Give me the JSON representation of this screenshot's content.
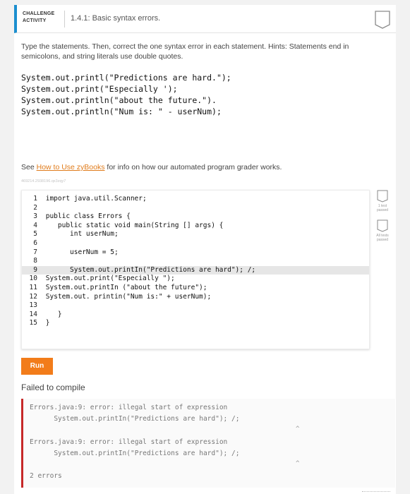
{
  "header": {
    "badge_line1": "CHALLENGE",
    "badge_line2": "ACTIVITY",
    "title": "1.4.1: Basic syntax errors."
  },
  "prompt": "Type the statements. Then, correct the one syntax error in each statement. Hints: Statements end in semicolons, and string literals use double quotes.",
  "statements": [
    "System.out.printl(\"Predictions are hard.\");",
    "System.out.print(\"Especially ');",
    "System.out.println(\"about the future.\").",
    "System.out.println(\"Num is: \" - userNum);"
  ],
  "see_note": {
    "prefix": "See ",
    "link": "How to Use zyBooks",
    "suffix": " for info on how our automated program grader works."
  },
  "identifier": "469214.2938196.qx3zqy7",
  "code": {
    "lines": [
      {
        "n": "1",
        "text": " import java.util.Scanner;"
      },
      {
        "n": "2",
        "text": ""
      },
      {
        "n": "3",
        "text": " public class Errors {"
      },
      {
        "n": "4",
        "text": "    public static void main(String [] args) {"
      },
      {
        "n": "5",
        "text": "       int userNum;"
      },
      {
        "n": "6",
        "text": ""
      },
      {
        "n": "7",
        "text": "       userNum = 5;"
      },
      {
        "n": "8",
        "text": ""
      },
      {
        "n": "9",
        "text": "       System.out.printIn(\"Predictions are hard\"); /;"
      },
      {
        "n": "10",
        "text": " System.out.print(\"Especially \");"
      },
      {
        "n": "11",
        "text": " System.out.printIn (\"about the future\");"
      },
      {
        "n": "12",
        "text": " System.out. printin(\"Num is:\" + userNum);"
      },
      {
        "n": "13",
        "text": ""
      },
      {
        "n": "14",
        "text": "    }"
      },
      {
        "n": "15",
        "text": " }"
      }
    ]
  },
  "tests": [
    {
      "label": "1 test passed"
    },
    {
      "label": "All tests passed"
    }
  ],
  "run_label": "Run",
  "status": "Failed to compile",
  "output": {
    "lines": [
      "Errors.java:9: error: illegal start of expression",
      "      System.out.printIn(\"Predictions are hard\"); /;",
      "^",
      "Errors.java:9: error: illegal start of expression",
      "      System.out.printIn(\"Predictions are hard\"); /;",
      "^",
      "2 errors"
    ]
  },
  "colors": {
    "accent_blue": "#1c8fcf",
    "run_orange": "#f27c1a",
    "error_red": "#c62828",
    "link_orange": "#e07b1a"
  }
}
